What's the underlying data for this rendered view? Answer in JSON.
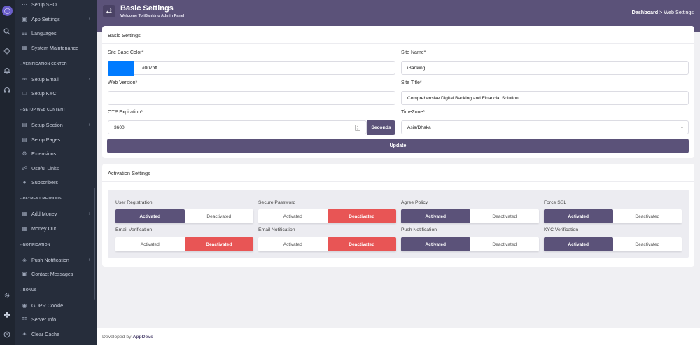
{
  "rail": {
    "icons": [
      "logo-icon",
      "search-icon",
      "crosshair-icon",
      "bell-icon",
      "support-icon",
      "gear-icon",
      "printer-icon",
      "clock-icon"
    ]
  },
  "sidebar": {
    "items": [
      {
        "label": "Setup SEO",
        "icon": "dots-icon",
        "chev": false
      },
      {
        "label": "App Settings",
        "icon": "app-icon",
        "chev": true
      },
      {
        "label": "Languages",
        "icon": "language-icon",
        "chev": false
      },
      {
        "label": "System Maintenance",
        "icon": "maintenance-icon",
        "chev": false
      },
      {
        "label": "Setup Email",
        "icon": "email-icon",
        "chev": true
      },
      {
        "label": "Setup KYC",
        "icon": "kyc-icon",
        "chev": false
      },
      {
        "label": "Setup Section",
        "icon": "section-icon",
        "chev": true
      },
      {
        "label": "Setup Pages",
        "icon": "pages-icon",
        "chev": false
      },
      {
        "label": "Extensions",
        "icon": "extension-icon",
        "chev": false
      },
      {
        "label": "Useful Links",
        "icon": "link-icon",
        "chev": false
      },
      {
        "label": "Subscribers",
        "icon": "subscribers-icon",
        "chev": false
      },
      {
        "label": "Add Money",
        "icon": "add-money-icon",
        "chev": true
      },
      {
        "label": "Money Out",
        "icon": "money-out-icon",
        "chev": false
      },
      {
        "label": "Push Notification",
        "icon": "push-icon",
        "chev": true
      },
      {
        "label": "Contact Messages",
        "icon": "message-icon",
        "chev": false
      },
      {
        "label": "GDPR Cookie",
        "icon": "cookie-icon",
        "chev": false
      },
      {
        "label": "Server Info",
        "icon": "server-icon",
        "chev": false
      },
      {
        "label": "Clear Cache",
        "icon": "broom-icon",
        "chev": false
      }
    ],
    "sections": [
      "VERIFICATION CENTER",
      "SETUP WEB CONTENT",
      "PAYMENT METHODS",
      "NOTIFICATION",
      "BONUS"
    ]
  },
  "header": {
    "title": "Basic Settings",
    "subtitle": "Welcome To iBanking Admin Panel",
    "crumb_home": "Dashboard",
    "crumb_sep": ">",
    "crumb_current": "Web Settings"
  },
  "basic": {
    "heading": "Basic Settings",
    "base_color_label": "Site Base Color*",
    "base_color_value": "#007bff",
    "site_name_label": "Site Name*",
    "site_name_value": "iBanking",
    "web_version_label": "Web Version*",
    "web_version_value": "",
    "site_title_label": "Site Title*",
    "site_title_value": "Comprehensive Digital Banking and Financial Solution",
    "otp_label": "OTP Expiration*",
    "otp_value": "3600",
    "otp_unit": "Seconds",
    "timezone_label": "TimeZone*",
    "timezone_value": "Asia/Dhaka",
    "update_label": "Update"
  },
  "activation": {
    "heading": "Activation Settings",
    "on_label": "Activated",
    "off_label": "Deactivated",
    "toggles": [
      {
        "label": "User Registration",
        "state": "activated"
      },
      {
        "label": "Secure Password",
        "state": "deactivated"
      },
      {
        "label": "Agree Policy",
        "state": "activated"
      },
      {
        "label": "Force SSL",
        "state": "activated"
      },
      {
        "label": "Email Verification",
        "state": "deactivated"
      },
      {
        "label": "Email Notification",
        "state": "deactivated"
      },
      {
        "label": "Push Notification",
        "state": "activated"
      },
      {
        "label": "KYC Verification",
        "state": "activated"
      }
    ]
  },
  "footer": {
    "prefix": "Developed by",
    "brand": "AppDevs"
  },
  "colors": {
    "primary": "#5b5279",
    "danger": "#e85555",
    "base": "#007bff"
  }
}
